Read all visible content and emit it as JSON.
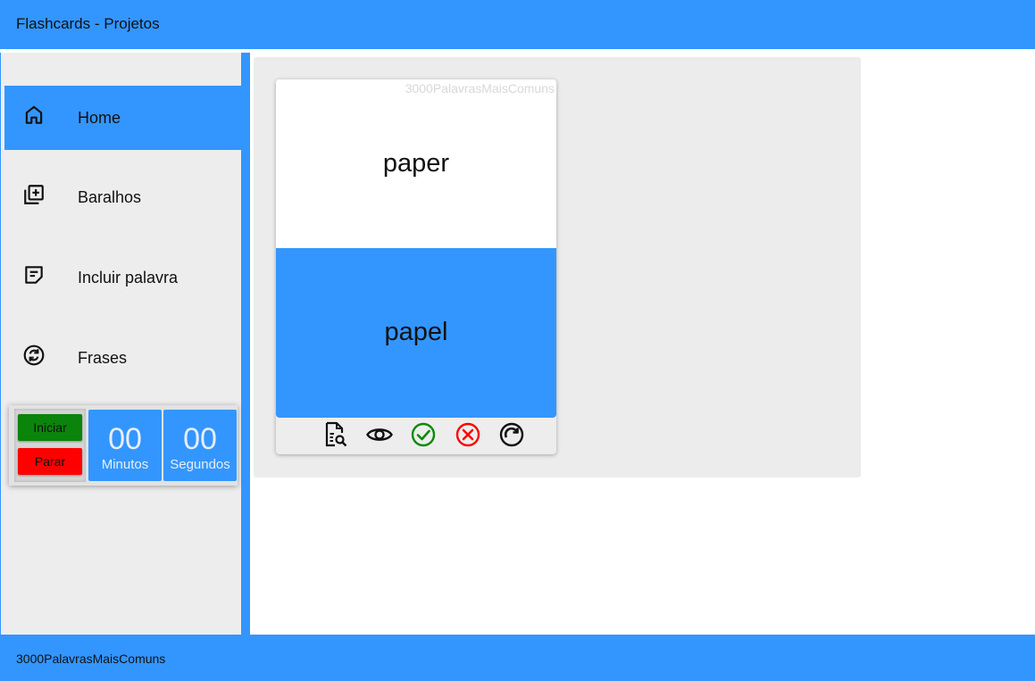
{
  "header": {
    "title": "Flashcards - Projetos"
  },
  "sidebar": {
    "items": [
      {
        "label": "Home",
        "icon": "home-icon",
        "active": true
      },
      {
        "label": "Baralhos",
        "icon": "add-library-icon"
      },
      {
        "label": "Incluir palavra",
        "icon": "note-icon"
      },
      {
        "label": "Frases",
        "icon": "sync-icon"
      }
    ]
  },
  "timer": {
    "start_label": "Iniciar",
    "stop_label": "Parar",
    "minutes_value": "00",
    "minutes_label": "Minutos",
    "seconds_value": "00",
    "seconds_label": "Segundos"
  },
  "card": {
    "deck": "3000PalavrasMaisComuns",
    "front": "paper",
    "back": "papel",
    "actions": [
      "search-document-icon",
      "eye-icon",
      "check-circle-icon",
      "x-circle-icon",
      "redo-icon"
    ]
  },
  "footer": {
    "text": "3000PalavrasMaisComuns"
  },
  "colors": {
    "accent": "#3396ff",
    "panel": "#ededed",
    "start": "#0a840a",
    "stop": "#ff0000",
    "correct": "#0a8a0a",
    "wrong": "#ff0000"
  }
}
